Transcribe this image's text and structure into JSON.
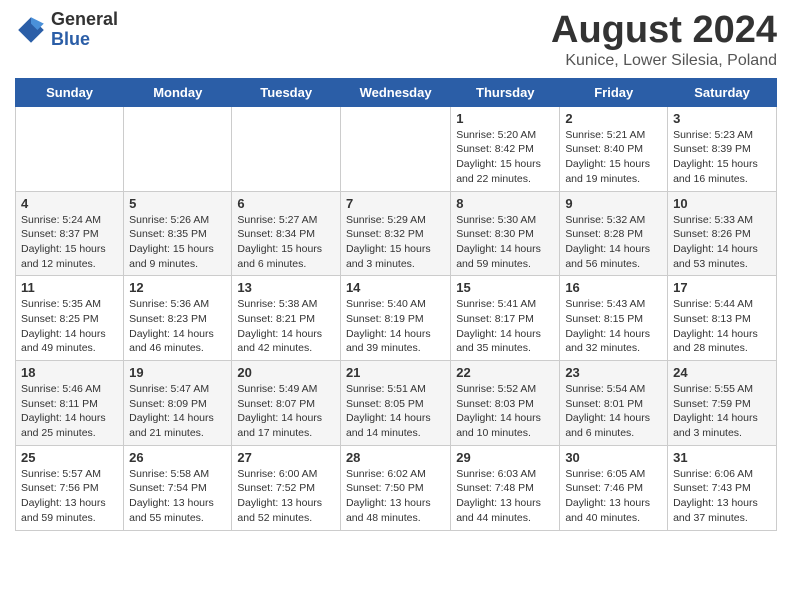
{
  "logo": {
    "general": "General",
    "blue": "Blue"
  },
  "title": "August 2024",
  "location": "Kunice, Lower Silesia, Poland",
  "days_of_week": [
    "Sunday",
    "Monday",
    "Tuesday",
    "Wednesday",
    "Thursday",
    "Friday",
    "Saturday"
  ],
  "weeks": [
    [
      {
        "num": "",
        "info": ""
      },
      {
        "num": "",
        "info": ""
      },
      {
        "num": "",
        "info": ""
      },
      {
        "num": "",
        "info": ""
      },
      {
        "num": "1",
        "info": "Sunrise: 5:20 AM\nSunset: 8:42 PM\nDaylight: 15 hours\nand 22 minutes."
      },
      {
        "num": "2",
        "info": "Sunrise: 5:21 AM\nSunset: 8:40 PM\nDaylight: 15 hours\nand 19 minutes."
      },
      {
        "num": "3",
        "info": "Sunrise: 5:23 AM\nSunset: 8:39 PM\nDaylight: 15 hours\nand 16 minutes."
      }
    ],
    [
      {
        "num": "4",
        "info": "Sunrise: 5:24 AM\nSunset: 8:37 PM\nDaylight: 15 hours\nand 12 minutes."
      },
      {
        "num": "5",
        "info": "Sunrise: 5:26 AM\nSunset: 8:35 PM\nDaylight: 15 hours\nand 9 minutes."
      },
      {
        "num": "6",
        "info": "Sunrise: 5:27 AM\nSunset: 8:34 PM\nDaylight: 15 hours\nand 6 minutes."
      },
      {
        "num": "7",
        "info": "Sunrise: 5:29 AM\nSunset: 8:32 PM\nDaylight: 15 hours\nand 3 minutes."
      },
      {
        "num": "8",
        "info": "Sunrise: 5:30 AM\nSunset: 8:30 PM\nDaylight: 14 hours\nand 59 minutes."
      },
      {
        "num": "9",
        "info": "Sunrise: 5:32 AM\nSunset: 8:28 PM\nDaylight: 14 hours\nand 56 minutes."
      },
      {
        "num": "10",
        "info": "Sunrise: 5:33 AM\nSunset: 8:26 PM\nDaylight: 14 hours\nand 53 minutes."
      }
    ],
    [
      {
        "num": "11",
        "info": "Sunrise: 5:35 AM\nSunset: 8:25 PM\nDaylight: 14 hours\nand 49 minutes."
      },
      {
        "num": "12",
        "info": "Sunrise: 5:36 AM\nSunset: 8:23 PM\nDaylight: 14 hours\nand 46 minutes."
      },
      {
        "num": "13",
        "info": "Sunrise: 5:38 AM\nSunset: 8:21 PM\nDaylight: 14 hours\nand 42 minutes."
      },
      {
        "num": "14",
        "info": "Sunrise: 5:40 AM\nSunset: 8:19 PM\nDaylight: 14 hours\nand 39 minutes."
      },
      {
        "num": "15",
        "info": "Sunrise: 5:41 AM\nSunset: 8:17 PM\nDaylight: 14 hours\nand 35 minutes."
      },
      {
        "num": "16",
        "info": "Sunrise: 5:43 AM\nSunset: 8:15 PM\nDaylight: 14 hours\nand 32 minutes."
      },
      {
        "num": "17",
        "info": "Sunrise: 5:44 AM\nSunset: 8:13 PM\nDaylight: 14 hours\nand 28 minutes."
      }
    ],
    [
      {
        "num": "18",
        "info": "Sunrise: 5:46 AM\nSunset: 8:11 PM\nDaylight: 14 hours\nand 25 minutes."
      },
      {
        "num": "19",
        "info": "Sunrise: 5:47 AM\nSunset: 8:09 PM\nDaylight: 14 hours\nand 21 minutes."
      },
      {
        "num": "20",
        "info": "Sunrise: 5:49 AM\nSunset: 8:07 PM\nDaylight: 14 hours\nand 17 minutes."
      },
      {
        "num": "21",
        "info": "Sunrise: 5:51 AM\nSunset: 8:05 PM\nDaylight: 14 hours\nand 14 minutes."
      },
      {
        "num": "22",
        "info": "Sunrise: 5:52 AM\nSunset: 8:03 PM\nDaylight: 14 hours\nand 10 minutes."
      },
      {
        "num": "23",
        "info": "Sunrise: 5:54 AM\nSunset: 8:01 PM\nDaylight: 14 hours\nand 6 minutes."
      },
      {
        "num": "24",
        "info": "Sunrise: 5:55 AM\nSunset: 7:59 PM\nDaylight: 14 hours\nand 3 minutes."
      }
    ],
    [
      {
        "num": "25",
        "info": "Sunrise: 5:57 AM\nSunset: 7:56 PM\nDaylight: 13 hours\nand 59 minutes."
      },
      {
        "num": "26",
        "info": "Sunrise: 5:58 AM\nSunset: 7:54 PM\nDaylight: 13 hours\nand 55 minutes."
      },
      {
        "num": "27",
        "info": "Sunrise: 6:00 AM\nSunset: 7:52 PM\nDaylight: 13 hours\nand 52 minutes."
      },
      {
        "num": "28",
        "info": "Sunrise: 6:02 AM\nSunset: 7:50 PM\nDaylight: 13 hours\nand 48 minutes."
      },
      {
        "num": "29",
        "info": "Sunrise: 6:03 AM\nSunset: 7:48 PM\nDaylight: 13 hours\nand 44 minutes."
      },
      {
        "num": "30",
        "info": "Sunrise: 6:05 AM\nSunset: 7:46 PM\nDaylight: 13 hours\nand 40 minutes."
      },
      {
        "num": "31",
        "info": "Sunrise: 6:06 AM\nSunset: 7:43 PM\nDaylight: 13 hours\nand 37 minutes."
      }
    ]
  ]
}
